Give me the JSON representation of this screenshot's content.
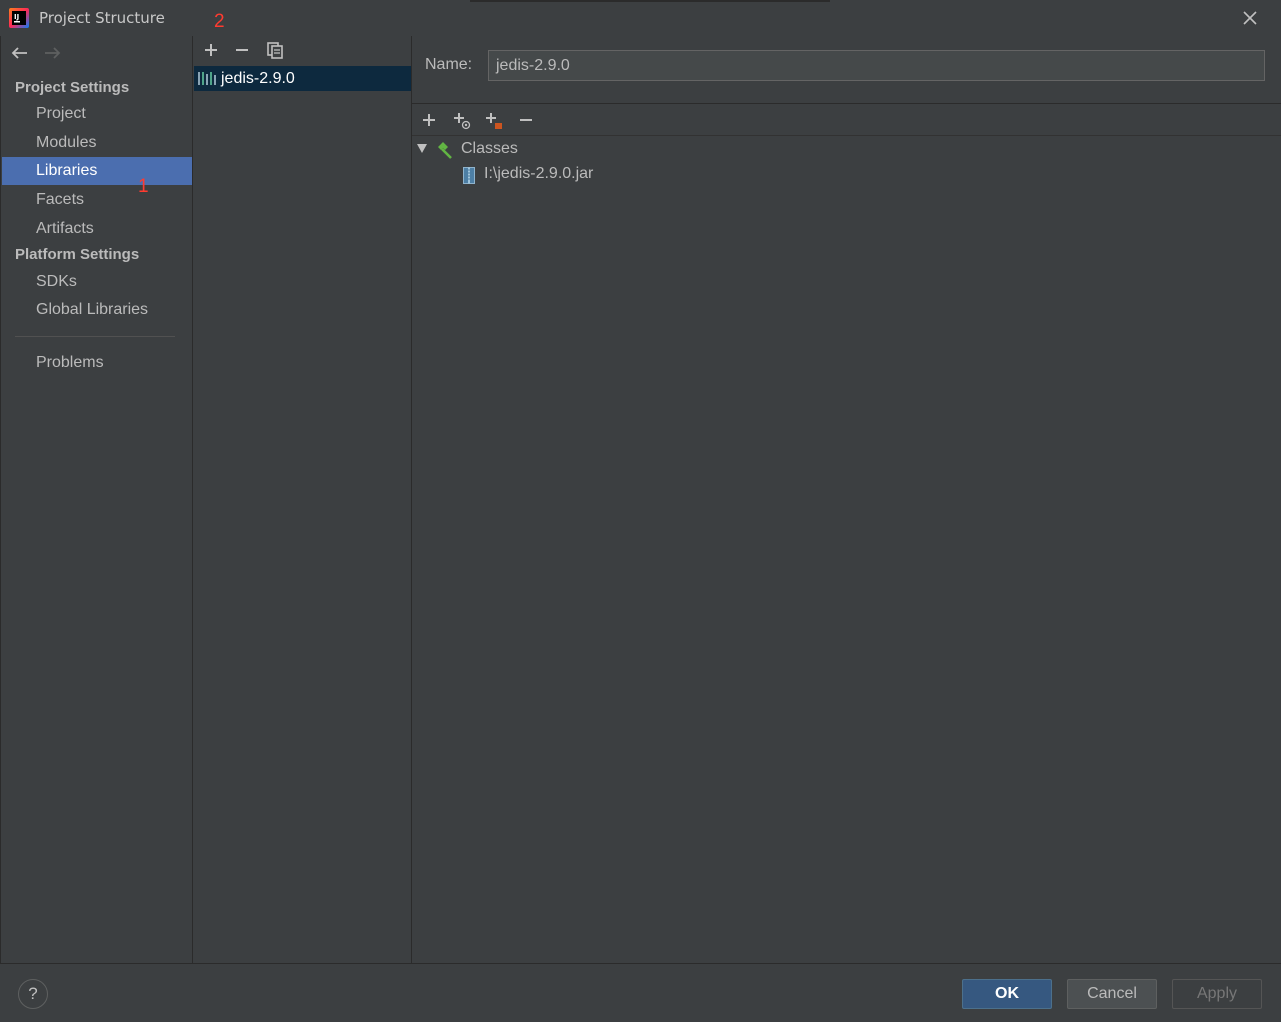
{
  "window": {
    "title": "Project Structure",
    "annotations": [
      "1",
      "2"
    ]
  },
  "left_nav": {
    "back_icon": "arrow-left-icon",
    "forward_icon": "arrow-right-icon",
    "project_settings_header": "Project Settings",
    "project_items": [
      "Project",
      "Modules",
      "Libraries",
      "Facets",
      "Artifacts"
    ],
    "platform_settings_header": "Platform Settings",
    "platform_items": [
      "SDKs",
      "Global Libraries"
    ],
    "problems": "Problems",
    "selected": "Libraries"
  },
  "library_list": {
    "toolbar_icons": [
      "plus-icon",
      "minus-icon",
      "copy-icon"
    ],
    "items": [
      "jedis-2.9.0"
    ],
    "selected": "jedis-2.9.0"
  },
  "library_detail": {
    "name_label": "Name:",
    "name_value": "jedis-2.9.0",
    "toolbar_icons": [
      "plus-icon",
      "add-with-config-icon",
      "add-jar-icon",
      "minus-icon"
    ],
    "tree": {
      "root": "Classes",
      "children": [
        "I:\\jedis-2.9.0.jar"
      ]
    }
  },
  "footer": {
    "help": "?",
    "ok": "OK",
    "cancel": "Cancel",
    "apply": "Apply"
  },
  "colors": {
    "background": "#3c3f41",
    "selection": "#4b6eaf",
    "list_selection": "#0d293e",
    "primary_button": "#365880",
    "annotation": "#ff3b30"
  }
}
